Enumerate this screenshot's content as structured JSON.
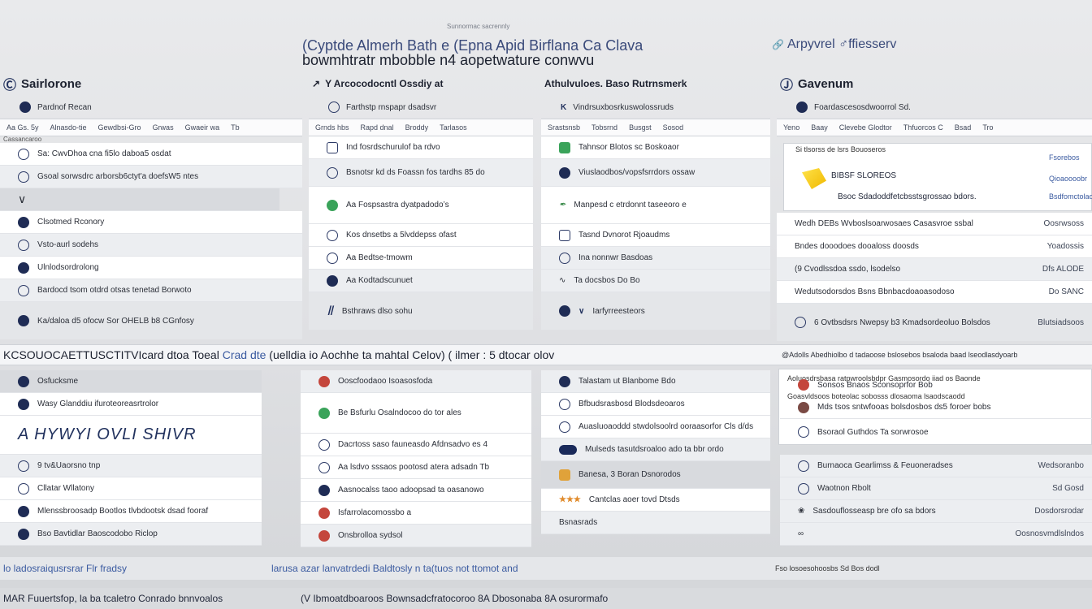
{
  "header": {
    "tiny": "Sunnormac sacrennly",
    "title": "(Cyptde Almerh Bath e (Epna Apid Birflana Ca Clava",
    "subtitle": "bowmhtratr mbobble n4 aopetwature conwvu",
    "right_title": "Arpyvrel ♂ffiesserv"
  },
  "col1": {
    "title": "Sairlorone",
    "sub": "Pardnof Recan",
    "tabs": [
      "Aa Gs. 5y",
      "Alnasdo-tie",
      "Gewdbsi-Gro",
      "Grwas",
      "Gwaeir wa",
      "Tb"
    ],
    "note": "Cassancaroo",
    "rows": [
      {
        "label": "Sa: CwvDhoa cna fi5lo daboa5 osdat",
        "style": "white"
      },
      {
        "label": "Gsoal sorwsdrc arborsb6ctyt'a doefsW5 ntes",
        "style": "grey"
      },
      {
        "label": "",
        "style": "dark"
      },
      {
        "label": "Clsotmed Rconory",
        "style": "white"
      },
      {
        "label": "Vsto-aurl sodehs",
        "style": "grey"
      },
      {
        "label": "Ulnlodsordrolong",
        "style": "white"
      },
      {
        "label": "Bardocd tsom otdrd otsas tenetad Borwoto",
        "style": "grey"
      }
    ],
    "summary": "Ka/daloa d5 ofocw Sor OHELB b8 CGnfosy",
    "lower_rows": [
      {
        "label": "Osfucksme",
        "style": "dark"
      },
      {
        "label": "Wasy Glanddiu ifuroteoreasrtrolor",
        "style": "white"
      },
      {
        "label": "A HYWYI OVLI   SHIVR",
        "style": "big"
      },
      {
        "label": "9 tv&Uaorsno tnp",
        "style": "grey"
      },
      {
        "label": "Cllatar Wllatony",
        "style": "white"
      },
      {
        "label": "Mlenssbroosadp  Bootlos  tlvbdootsk dsad fooraf",
        "style": "white"
      },
      {
        "label": "Bso  Bavtidlar Baoscodobo Riclop",
        "style": "grey"
      }
    ]
  },
  "col2": {
    "title": "Y Arcocodocntl Ossdiy at",
    "sub": "Farthstp rnspapr dsadsvr",
    "tabs": [
      "Grnds hbs",
      "Rapd dnal",
      "Broddy",
      "Tarlasos"
    ],
    "rows": [
      {
        "label": "Ind fosrdschurulof ba rdvo",
        "style": "white"
      },
      {
        "label": "Bsnotsr kd ds Foassn fos tardhs 85 do",
        "style": "grey"
      },
      {
        "label": "Aa Fospsastra dyatpadodo’s",
        "style": "white"
      },
      {
        "label": "Kos dnsetbs a 5lvddepss ofast",
        "style": "white"
      },
      {
        "label": "Aa Bedtse-tmowm",
        "style": "white"
      },
      {
        "label": "Aa Kodtadscunuet",
        "style": "grey"
      }
    ],
    "summary": "Bsthraws dlso sohu",
    "lower_rows": [
      {
        "label": "Ooscfoodaoo Isoasosfoda",
        "style": "grey"
      },
      {
        "label": "Be Bsfurlu Osalndocoo do tor ales",
        "style": "white"
      },
      {
        "label": "Dacrtoss saso fauneasdo Afdnsadvo es 4",
        "style": "white"
      },
      {
        "label": "Aa lsdvo sssaos pootosd atera adsadn Tb",
        "style": "white"
      },
      {
        "label": "Aasnocalss taoo adoopsad ta oasanowo",
        "style": "white"
      },
      {
        "label": "Isfarrolacomossbo a",
        "style": "white"
      },
      {
        "label": "Onsbrolloa sydsol",
        "style": "grey"
      }
    ]
  },
  "col3": {
    "title": "Athulvuloes. Baso Rutrnsmerk",
    "sub": "Vindrsuxbosrkuswolossruds",
    "tabs": [
      "Srastsnsb",
      "Tobsrnd",
      "Busgst",
      "Sosod"
    ],
    "rows": [
      {
        "label": "Tahnsor  Blotos sc  Boskoaor",
        "style": "white"
      },
      {
        "label": "Viuslaodbos/vopsfsrrdors ossaw",
        "style": "grey"
      },
      {
        "label": "Manpesd c etrdonnt  taseeoro e",
        "style": "white"
      },
      {
        "label": "Tasnd  Dvnorot  Rjoaudms",
        "style": "white"
      },
      {
        "label": "Ina  nonnwr Basdoas",
        "style": "grey"
      },
      {
        "label": "Ta docsbos  Do Bo",
        "style": "grey"
      }
    ],
    "summary": "Iarfyrreesteors",
    "lower_rows": [
      {
        "label": "Talastam ut Blanbome Bdo",
        "style": "grey"
      },
      {
        "label": "Bfbudsrasbosd Blodsdeoaros",
        "style": "white"
      },
      {
        "label": "Auasluoaoddd stwdolsoolrd ooraasorfor Cls d/ds",
        "style": "white"
      },
      {
        "label": "Mulseds tasutdsroaloo ado ta bbr ordo",
        "style": "grey"
      },
      {
        "label": "Banesa,  3   Boran  Dsnorodos",
        "style": "dark"
      },
      {
        "label": "Cantclas  aoer tovd Dtsds",
        "style": "white"
      },
      {
        "label": "Bsnasrads",
        "style": "grey"
      }
    ]
  },
  "col4": {
    "title": "Gavenum",
    "sub": "Foardascesosdwoorrol Sd.",
    "tabs": [
      "Yeno",
      "Baay",
      "Clevebe Glodtor",
      "Thfuorcos C",
      "Bsad",
      "Tro"
    ],
    "callout": {
      "top": "Si tlsorss de lsrs Bouoseros",
      "line2": "BIBSF SLOREOS",
      "line3": "Bsoc Sdadoddfetcbsstsgrossao bdors.",
      "right": [
        "Fsorebos",
        "Qioaoooobr",
        "Bsdfomctolaos"
      ]
    },
    "rows": [
      {
        "label": "Wedh  DEBs Wvboslsoarwosaes Casasvroe ssbal",
        "right": "Oosrwsoss",
        "style": "white"
      },
      {
        "label": "Bndes dooodoes dooaloss doosds",
        "right": "Yoadossis",
        "style": "white"
      },
      {
        "label": "(9  Cvodlssdoa ssdo, lsodelso",
        "right": "Dfs ALODE",
        "style": "grey"
      },
      {
        "label": "Wedutsodorsdos Bsns Bbnbacdoaoasodoso",
        "right": "Do SANC",
        "style": "white"
      }
    ],
    "summary": "6 Ovtbsdsrs Nwepsy b3 Kmadsordeoluo Bolsdos",
    "summary_right": "Blutsiadsoos",
    "band_rows": [
      {
        "label": "Aoluosdrsbasa ratpwroolsbdpr Gasmosordo iiad os Baonde",
        "style": "white"
      },
      {
        "label": "Goasvldsoos boteolac sobosss dlosaoma lsaodscaodd",
        "style": "white"
      }
    ],
    "lower_rows": [
      {
        "label": "Sonsos Bnaos  Sconsoprfor Bob",
        "style": "white"
      },
      {
        "label": "Mds tsos sntwfooas bolsdosbos ds5 foroer bobs",
        "style": "white"
      },
      {
        "label": "Bsoraol Guthdos  Ta sorwrosoe",
        "style": "white"
      },
      {
        "label": "Burnaoca Gearlimss &  Feuoneradses",
        "right": "Wedsoranbo",
        "style": "grey"
      },
      {
        "label": "Waotnon Rbolt",
        "right": "Sd  Gosd",
        "style": "grey"
      },
      {
        "label": "Sasdouflosseasp bre ofo sa bdors",
        "right": "Dosdorsrodar",
        "style": "grey"
      },
      {
        "label": "",
        "right": "Oosnosvmdlslndos",
        "style": "grey"
      }
    ]
  },
  "band": {
    "left_a": "KCSOUOCAETTUSCTITVIcard  dtoa  Toeal ",
    "left_b": "Crad dte",
    "left_c": " (uelldia  io Aochhe  ta mahtal  Celov) ( ilmer : 5  dtocar  olov",
    "right": "@Adolls  Abedhiolbo d tadaoose  bslosebos bsaloda baad  lseodlasdyoarb"
  },
  "footer": {
    "line1_left": "lo  ladosraiqusrsrar Flr fradsy",
    "line1_mid": "larusa azar lanvatrdedi Baldtosly n ta(tuos  not ttomot and",
    "line1_right": "Fso losoesohoosbs Sd  Bos dodl",
    "line2_left": "MAR Fuuertsfop, la  ba tcaletro Conrado bnnvoalos",
    "line2_mid": "(V Ibmoatdboaroos  Bownsadcfratocoroo  8A  Dbosonaba  8A  osurormafo"
  },
  "colors": {
    "accent": "#2c3a66",
    "band_blue": "#3a5aa0",
    "callout_yellow": "#f5c800"
  }
}
